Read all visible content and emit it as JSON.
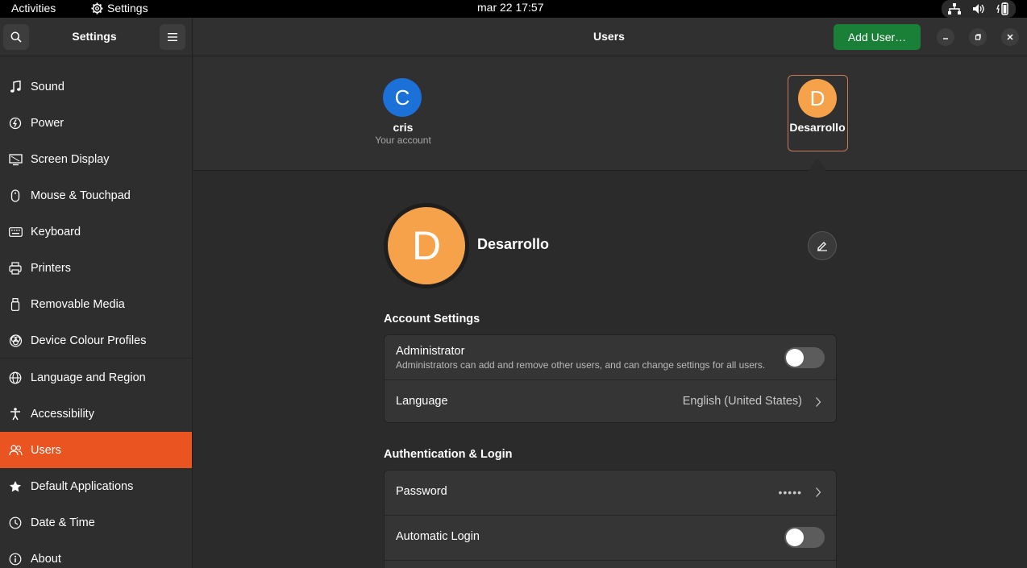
{
  "topbar": {
    "activities": "Activities",
    "app_name": "Settings",
    "clock": "mar 22  17:57",
    "tray_icons": [
      "network-icon",
      "volume-icon",
      "battery-icon"
    ]
  },
  "header": {
    "sidebar_title": "Settings",
    "page_title": "Users",
    "add_user_label": "Add User…"
  },
  "sidebar": {
    "items": [
      {
        "label": "Sound",
        "icon": "music-note-icon"
      },
      {
        "label": "Power",
        "icon": "power-icon"
      },
      {
        "label": "Screen Display",
        "icon": "display-icon"
      },
      {
        "label": "Mouse & Touchpad",
        "icon": "mouse-icon"
      },
      {
        "label": "Keyboard",
        "icon": "keyboard-icon"
      },
      {
        "label": "Printers",
        "icon": "printer-icon"
      },
      {
        "label": "Removable Media",
        "icon": "removable-media-icon"
      },
      {
        "label": "Device Colour Profiles",
        "icon": "colour-profile-icon"
      },
      {
        "label": "Language and Region",
        "icon": "globe-icon"
      },
      {
        "label": "Accessibility",
        "icon": "accessibility-icon"
      },
      {
        "label": "Users",
        "icon": "users-icon",
        "active": true
      },
      {
        "label": "Default Applications",
        "icon": "star-icon"
      },
      {
        "label": "Date & Time",
        "icon": "clock-icon"
      },
      {
        "label": "About",
        "icon": "info-icon"
      }
    ]
  },
  "users": [
    {
      "initial": "C",
      "name": "cris",
      "subtitle": "Your account",
      "color": "#1c71d8"
    },
    {
      "initial": "D",
      "name": "Desarrollo",
      "color": "#f6a24b",
      "selected": true
    }
  ],
  "selected_user": {
    "initial": "D",
    "full_name": "Desarrollo"
  },
  "account_settings": {
    "title": "Account Settings",
    "administrator_label": "Administrator",
    "administrator_desc": "Administrators can add and remove other users, and can change settings for all users.",
    "administrator_on": false,
    "language_label": "Language",
    "language_value": "English (United States)"
  },
  "auth": {
    "title": "Authentication & Login",
    "password_label": "Password",
    "password_value": "•••••",
    "autologin_label": "Automatic Login",
    "autologin_on": false
  },
  "colors": {
    "accent": "#e95420",
    "add_user_button": "#1a7f37"
  }
}
